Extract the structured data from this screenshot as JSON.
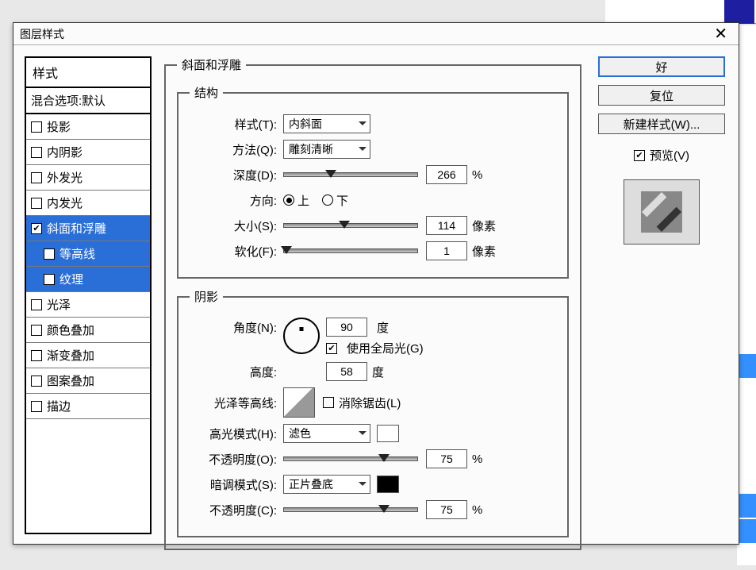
{
  "dialog": {
    "title": "图层样式"
  },
  "styles": {
    "header": "样式",
    "blend_default": "混合选项:默认",
    "items": [
      {
        "label": "投影",
        "checked": false
      },
      {
        "label": "内阴影",
        "checked": false
      },
      {
        "label": "外发光",
        "checked": false
      },
      {
        "label": "内发光",
        "checked": false
      },
      {
        "label": "斜面和浮雕",
        "checked": true,
        "selected": true
      },
      {
        "label": "等高线",
        "checked": false,
        "selected": true,
        "indent": true
      },
      {
        "label": "纹理",
        "checked": false,
        "selected": true,
        "indent": true
      },
      {
        "label": "光泽",
        "checked": false
      },
      {
        "label": "颜色叠加",
        "checked": false
      },
      {
        "label": "渐变叠加",
        "checked": false
      },
      {
        "label": "图案叠加",
        "checked": false
      },
      {
        "label": "描边",
        "checked": false
      }
    ]
  },
  "bevel": {
    "group_title": "斜面和浮雕",
    "structure_title": "结构",
    "style_label": "样式(T):",
    "style_value": "内斜面",
    "technique_label": "方法(Q):",
    "technique_value": "雕刻清晰",
    "depth_label": "深度(D):",
    "depth_value": "266",
    "depth_unit": "%",
    "direction_label": "方向:",
    "direction_up": "上",
    "direction_down": "下",
    "size_label": "大小(S):",
    "size_value": "114",
    "size_unit": "像素",
    "soften_label": "软化(F):",
    "soften_value": "1",
    "soften_unit": "像素"
  },
  "shading": {
    "group_title": "阴影",
    "angle_label": "角度(N):",
    "angle_value": "90",
    "angle_unit": "度",
    "global_light_label": "使用全局光(G)",
    "altitude_label": "高度:",
    "altitude_value": "58",
    "altitude_unit": "度",
    "gloss_label": "光泽等高线:",
    "antialias_label": "消除锯齿(L)",
    "highlight_mode_label": "高光模式(H):",
    "highlight_mode_value": "滤色",
    "highlight_color": "#ffffff",
    "highlight_opacity_label": "不透明度(O):",
    "highlight_opacity_value": "75",
    "highlight_opacity_unit": "%",
    "shadow_mode_label": "暗调模式(S):",
    "shadow_mode_value": "正片叠底",
    "shadow_color": "#000000",
    "shadow_opacity_label": "不透明度(C):",
    "shadow_opacity_value": "75",
    "shadow_opacity_unit": "%"
  },
  "buttons": {
    "ok": "好",
    "reset": "复位",
    "new_style": "新建样式(W)...",
    "preview": "预览(V)"
  }
}
